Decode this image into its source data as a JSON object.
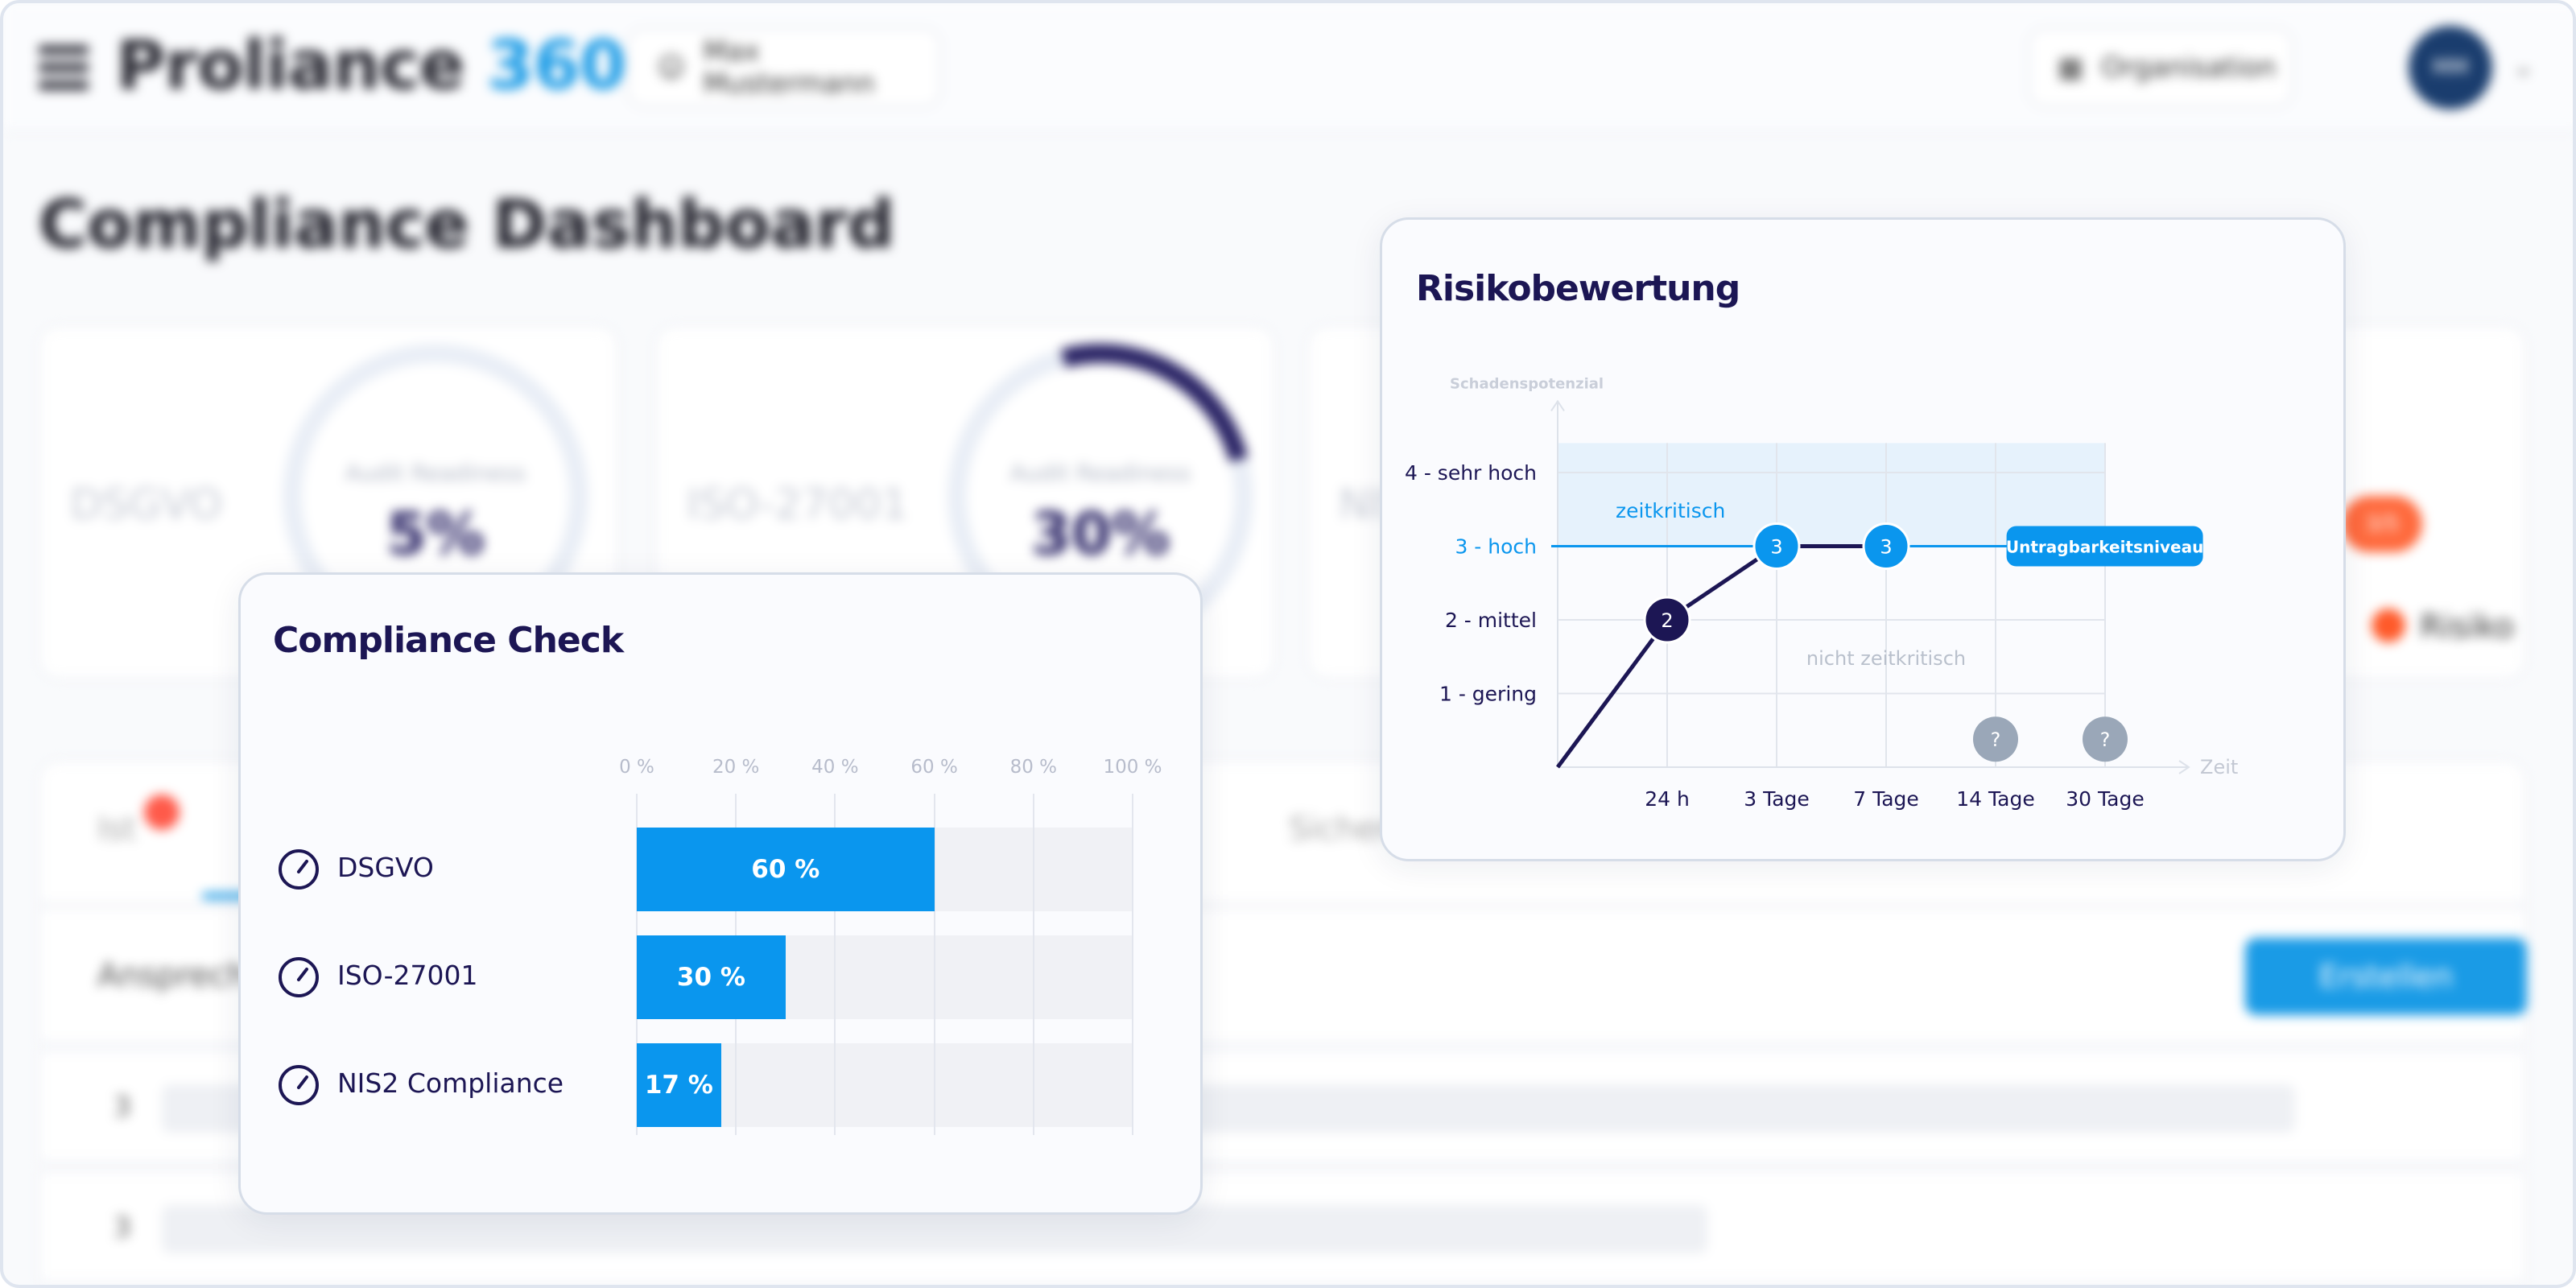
{
  "app": {
    "logo_main": "Proliance",
    "logo_accent": "360",
    "user_button": "Max Mustermann",
    "org_button": "Organisation",
    "avatar_initials": "MM"
  },
  "page": {
    "title": "Compliance Dashboard",
    "kpis": [
      {
        "name": "DSGVO",
        "ring_label": "Audit Readiness",
        "value": "5%",
        "progress": 0.05
      },
      {
        "name": "ISO-27001",
        "ring_label": "Audit Readiness",
        "value": "30%",
        "progress": 0.3
      },
      {
        "name": "NIS2",
        "ring_label": "",
        "value": "",
        "progress": 0
      }
    ],
    "risk_pill": "3/5",
    "risk_label": "Risiko",
    "tabs": [
      "Ist",
      "Sicherheit"
    ],
    "action_label": "Ansprechpartner",
    "create_button": "Erstellen",
    "list_rows": [
      "3",
      "3"
    ]
  },
  "compliance_check": {
    "title": "Compliance Check",
    "chart_data": {
      "type": "bar",
      "orientation": "horizontal",
      "categories": [
        "DSGVO",
        "ISO-27001",
        "NIS2 Compliance"
      ],
      "values": [
        60,
        30,
        17
      ],
      "value_labels": [
        "60 %",
        "30 %",
        "17 %"
      ],
      "ticks": [
        "0 %",
        "20 %",
        "40 %",
        "60 %",
        "80 %",
        "100 %"
      ],
      "xlim": [
        0,
        100
      ],
      "bar_color": "#0a96ee",
      "track_color": "#f0f1f5",
      "icon": "gauge-icon"
    }
  },
  "risk_assessment": {
    "title": "Risikobewertung",
    "chart_data": {
      "type": "line",
      "ylabel": "Schadenspotenzial",
      "xlabel": "Zeit",
      "y_categories": [
        "1 - gering",
        "2 - mittel",
        "3 - hoch",
        "4 - sehr hoch"
      ],
      "x_categories": [
        "24 h",
        "3 Tage",
        "7 Tage",
        "14 Tage",
        "30 Tage"
      ],
      "series": [
        {
          "points": [
            {
              "x": "0",
              "y": 0,
              "label": ""
            },
            {
              "x": "24 h",
              "y": 2,
              "label": "2"
            },
            {
              "x": "3 Tage",
              "y": 3,
              "label": "3"
            },
            {
              "x": "7 Tage",
              "y": 3,
              "label": "3"
            }
          ]
        }
      ],
      "unknown_points": [
        {
          "x": "14 Tage",
          "label": "?"
        },
        {
          "x": "30 Tage",
          "label": "?"
        }
      ],
      "threshold": {
        "y": 3,
        "label": "Untragbarkeitsniveau"
      },
      "region_above_label": "zeitkritisch",
      "region_below_label": "nicht zeitkritisch",
      "colors": {
        "line": "#1c1654",
        "accent": "#0a96ee",
        "zone": "#e6f2fc",
        "unknown": "#9aa7b8"
      }
    }
  }
}
